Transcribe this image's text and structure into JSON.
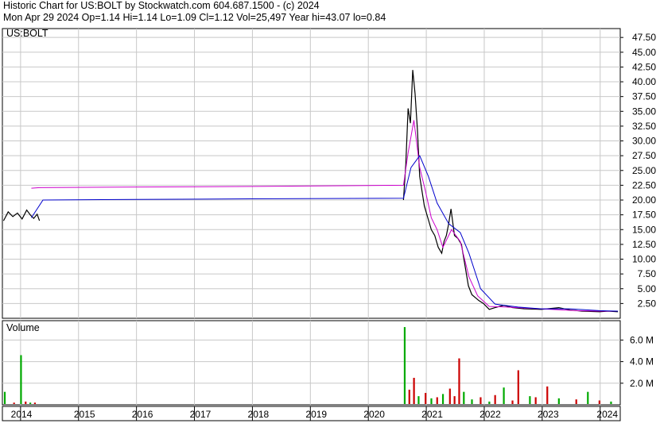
{
  "header": {
    "line1": "Historic Chart for US:BOLT by Stockwatch.com 604.687.1500 - (c) 2024",
    "line2": "Mon Apr 29 2024  Op=1.14  Hi=1.14  Lo=1.09  Cl=1.12  Vol=25,497  Year hi=43.07  lo=0.84"
  },
  "quote": {
    "symbol": "US:BOLT",
    "date": "Mon Apr 29 2024",
    "open": 1.14,
    "high": 1.14,
    "low": 1.09,
    "close": 1.12,
    "volume": 25497,
    "year_high": 43.07,
    "year_low": 0.84
  },
  "colors": {
    "price": "#000000",
    "ma_short": "#cc00cc",
    "ma_long": "#0000cc",
    "volume_up": "#00aa00",
    "volume_down": "#cc0000",
    "grid": "#c8c8c8"
  },
  "chart_data": [
    {
      "type": "line",
      "panel": "price",
      "title": "US:BOLT",
      "x_unit": "year",
      "ylim": [
        0,
        49
      ],
      "y_ticks": [
        "47.50",
        "45.00",
        "42.50",
        "40.00",
        "37.50",
        "35.00",
        "32.50",
        "30.00",
        "27.50",
        "25.00",
        "22.50",
        "20.00",
        "17.50",
        "15.00",
        "12.50",
        "10.00",
        "7.50",
        "5.00",
        "2.50"
      ],
      "grid": true,
      "series": [
        {
          "role": "price",
          "x": [
            2013.72,
            2013.8,
            2013.88,
            2013.96,
            2014.04,
            2014.12,
            2014.18,
            2014.24,
            2014.3,
            2014.34,
            2020.62,
            2020.66,
            2020.7,
            2020.74,
            2020.78,
            2020.82,
            2020.86,
            2020.9,
            2020.94,
            2020.98,
            2021.04,
            2021.1,
            2021.16,
            2021.22,
            2021.28,
            2021.32,
            2021.36,
            2021.4,
            2021.44,
            2021.5,
            2021.56,
            2021.62,
            2021.68,
            2021.74,
            2021.8,
            2021.86,
            2021.92,
            2022.0,
            2022.1,
            2022.2,
            2022.35,
            2022.5,
            2022.7,
            2023.0,
            2023.3,
            2023.5,
            2023.7,
            2024.0,
            2024.15,
            2024.32
          ],
          "y": [
            16.5,
            18.0,
            17.2,
            17.8,
            16.8,
            18.3,
            17.5,
            16.9,
            17.6,
            16.5,
            20.0,
            26.0,
            35.5,
            33.0,
            42.0,
            38.0,
            32.0,
            24.0,
            21.5,
            19.0,
            17.0,
            15.0,
            14.0,
            12.0,
            11.0,
            13.0,
            14.0,
            16.0,
            18.5,
            14.0,
            13.5,
            12.5,
            9.0,
            5.5,
            4.0,
            3.5,
            3.0,
            2.5,
            1.5,
            1.8,
            2.2,
            1.8,
            1.6,
            1.5,
            1.8,
            1.4,
            1.2,
            1.1,
            1.2,
            1.1
          ]
        },
        {
          "role": "moving-average-short",
          "x": [
            2014.2,
            2014.34,
            2016.0,
            2018.0,
            2020.62,
            2020.7,
            2020.8,
            2020.9,
            2021.0,
            2021.1,
            2021.2,
            2021.3,
            2021.45,
            2021.6,
            2021.75,
            2021.9,
            2022.1,
            2022.4,
            2022.8,
            2023.2,
            2023.6,
            2024.0,
            2024.32
          ],
          "y": [
            22.0,
            22.1,
            22.2,
            22.3,
            22.5,
            28.0,
            33.5,
            25.5,
            21.5,
            17.0,
            15.0,
            12.0,
            15.0,
            13.0,
            7.0,
            3.8,
            2.0,
            1.9,
            1.7,
            1.5,
            1.3,
            1.2,
            1.2
          ]
        },
        {
          "role": "moving-average-long",
          "x": [
            2014.2,
            2014.4,
            2016.0,
            2018.0,
            2020.62,
            2020.75,
            2020.9,
            2021.05,
            2021.2,
            2021.4,
            2021.6,
            2021.75,
            2021.95,
            2022.2,
            2022.6,
            2023.0,
            2023.5,
            2024.0,
            2024.32
          ],
          "y": [
            17.0,
            20.0,
            20.1,
            20.2,
            20.3,
            25.5,
            27.5,
            24.0,
            19.5,
            16.0,
            14.5,
            11.0,
            5.0,
            2.4,
            1.9,
            1.6,
            1.6,
            1.3,
            1.2
          ]
        }
      ]
    },
    {
      "type": "bar",
      "panel": "volume",
      "title": "Volume",
      "x_unit": "year",
      "ylim": [
        0,
        7.5
      ],
      "y_unit": "M",
      "y_ticks": [
        "6.0 M",
        "4.0 M",
        "2.0 M"
      ],
      "x_ticks": [
        "2014",
        "2015",
        "2016",
        "2017",
        "2018",
        "2019",
        "2020",
        "2021",
        "2022",
        "2023",
        "2024"
      ],
      "grid": true,
      "bars": {
        "x": [
          2013.74,
          2013.9,
          2014.02,
          2014.1,
          2014.18,
          2014.26,
          2020.64,
          2020.72,
          2020.8,
          2020.88,
          2021.0,
          2021.1,
          2021.2,
          2021.3,
          2021.42,
          2021.5,
          2021.58,
          2021.66,
          2021.8,
          2021.95,
          2022.1,
          2022.2,
          2022.35,
          2022.5,
          2022.6,
          2022.8,
          2022.9,
          2023.1,
          2023.3,
          2023.6,
          2023.8,
          2024.0,
          2024.2
        ],
        "values": [
          1.2,
          0.2,
          4.6,
          0.3,
          0.2,
          0.2,
          7.2,
          1.4,
          2.5,
          0.8,
          1.1,
          0.6,
          0.7,
          1.0,
          1.5,
          0.8,
          4.3,
          1.2,
          0.5,
          0.7,
          0.3,
          0.9,
          1.6,
          0.4,
          3.2,
          0.8,
          0.7,
          1.7,
          0.6,
          0.5,
          1.2,
          0.4,
          0.3
        ],
        "direction": [
          "up",
          "down",
          "up",
          "down",
          "up",
          "down",
          "up",
          "down",
          "down",
          "up",
          "down",
          "up",
          "down",
          "up",
          "down",
          "down",
          "down",
          "up",
          "up",
          "down",
          "up",
          "down",
          "up",
          "down",
          "down",
          "up",
          "down",
          "down",
          "up",
          "down",
          "up",
          "down",
          "up"
        ]
      }
    }
  ]
}
